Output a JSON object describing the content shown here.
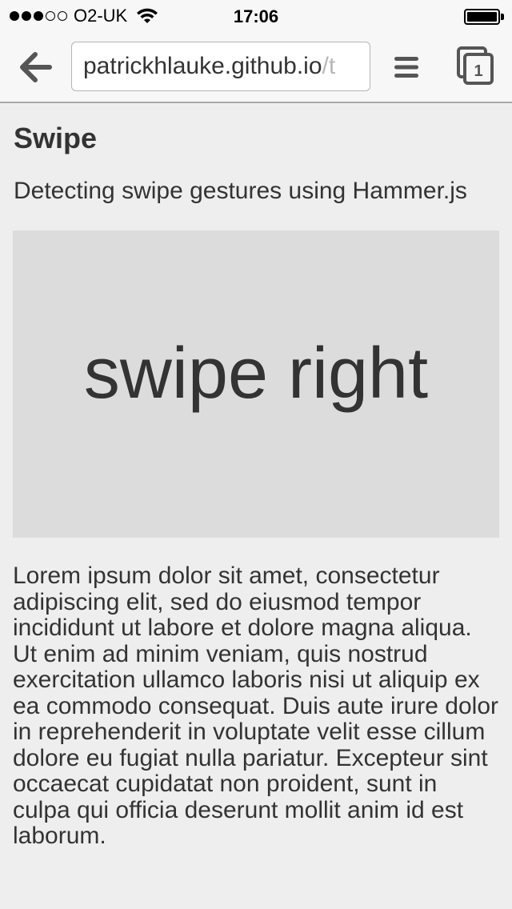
{
  "status_bar": {
    "carrier": "O2-UK",
    "time": "17:06",
    "signal_bars_filled": 3,
    "signal_bars_total": 5
  },
  "browser": {
    "url_host": "patrickhlauke.github.io",
    "url_rest": "/t",
    "tab_count": "1",
    "icons": {
      "back": "back-arrow-icon",
      "menu": "hamburger-menu-icon",
      "tabs": "tabs-icon"
    }
  },
  "page": {
    "title": "Swipe",
    "subtitle": "Detecting swipe gestures using Hammer.js",
    "swipe_area_text": "swipe right",
    "body_text": "Lorem ipsum dolor sit amet, consectetur adipiscing elit, sed do eiusmod tempor incididunt ut labore et dolore magna aliqua. Ut enim ad minim veniam, quis nostrud exercitation ullamco laboris nisi ut aliquip ex ea commodo consequat. Duis aute irure dolor in reprehenderit in voluptate velit esse cillum dolore eu fugiat nulla pariatur. Excepteur sint occaecat cupidatat non proident, sunt in culpa qui officia deserunt mollit anim id est laborum."
  },
  "colors": {
    "background": "#eeeeee",
    "toolbar": "#f7f7f7",
    "swipe_area": "#dcdcdc",
    "text": "#333333"
  }
}
